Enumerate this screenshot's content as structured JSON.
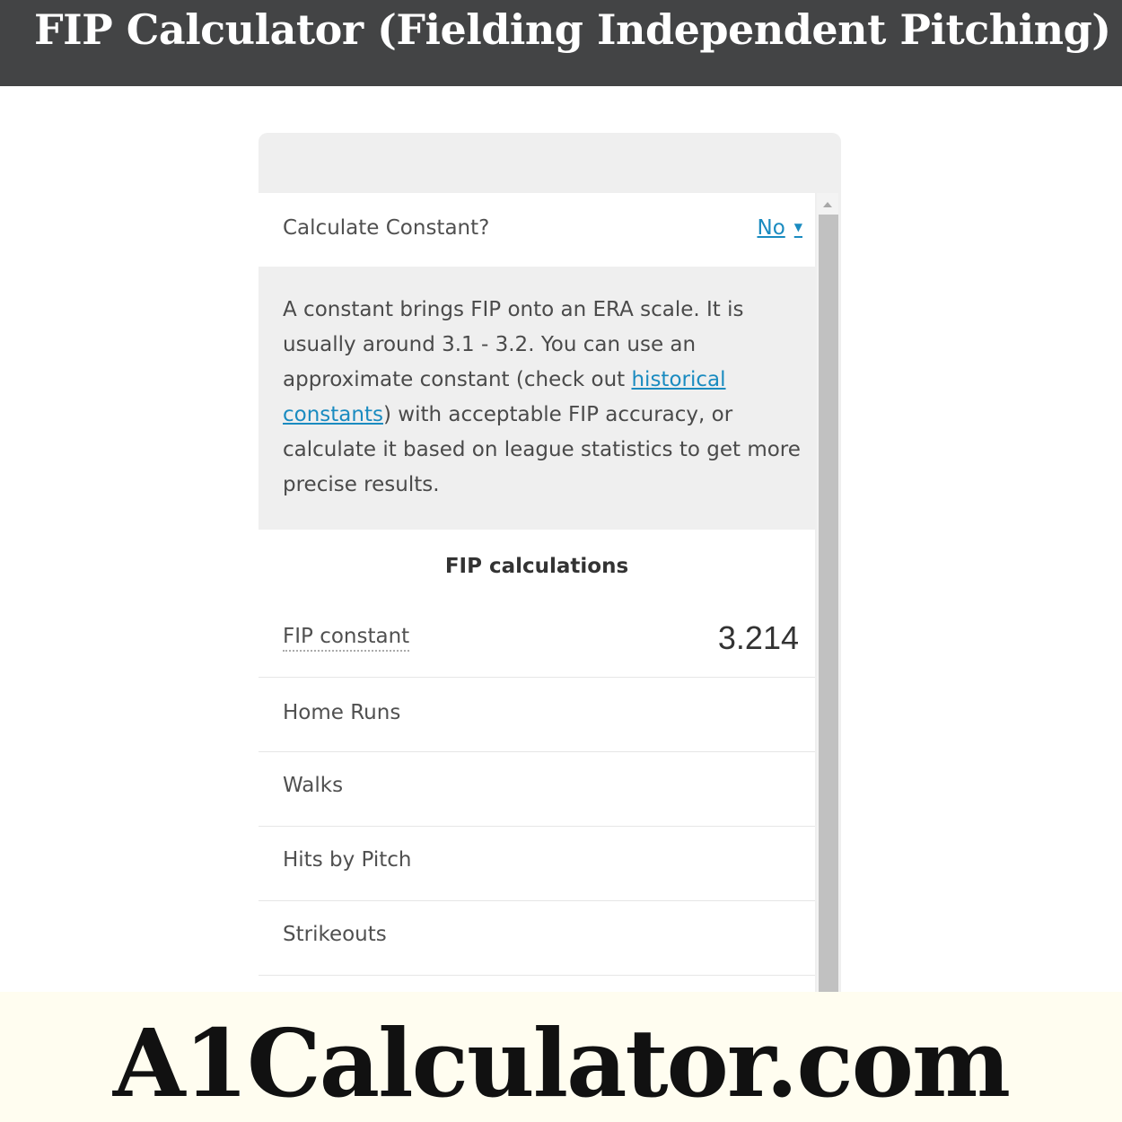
{
  "header": {
    "title": "FIP Calculator (Fielding Independent Pitching)"
  },
  "calculator": {
    "calculate_constant": {
      "label": "Calculate Constant?",
      "value": "No",
      "arrow": "▼"
    },
    "info": {
      "text_before_link": "A constant brings FIP onto an ERA scale. It is usually around 3.1 - 3.2. You can use an approximate constant (check out ",
      "link_text": "historical constants",
      "text_after_link": ") with acceptable FIP accuracy, or calculate it based on league statistics to get more precise results."
    },
    "section_title": "FIP calculations",
    "fields": [
      {
        "label": "FIP constant",
        "value": "3.214"
      },
      {
        "label": "Home Runs",
        "value": ""
      },
      {
        "label": "Walks",
        "value": ""
      },
      {
        "label": "Hits by Pitch",
        "value": ""
      },
      {
        "label": "Strikeouts",
        "value": ""
      }
    ]
  },
  "branding": {
    "text": "A1Calculator.com"
  }
}
